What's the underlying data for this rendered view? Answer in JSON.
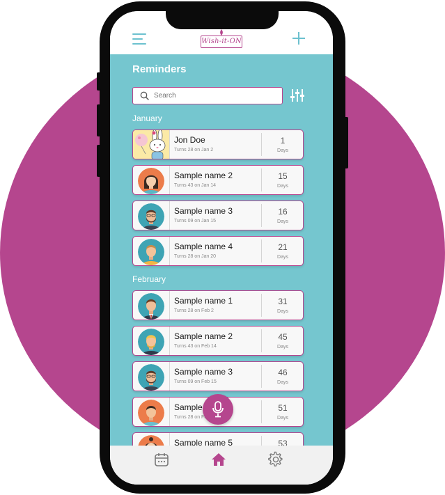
{
  "header": {
    "logo_text": "Wish-it-ON"
  },
  "screen": {
    "title": "Reminders"
  },
  "search": {
    "placeholder": "Search"
  },
  "months": [
    {
      "label": "January",
      "reminders": [
        {
          "name": "Jon Doe",
          "subtitle": "Turns 28 on Jan 2",
          "days": "1",
          "days_label": "Days",
          "avatar": "bunny-illustration"
        },
        {
          "name": "Sample name 2",
          "subtitle": "Turns 43 on Jan 14",
          "days": "15",
          "days_label": "Days",
          "avatar": "woman-avatar"
        },
        {
          "name": "Sample name 3",
          "subtitle": "Turns 09 on Jan 15",
          "days": "16",
          "days_label": "Days",
          "avatar": "bearded-man-avatar"
        },
        {
          "name": "Sample name 4",
          "subtitle": "Turns 28 on Jan 20",
          "days": "21",
          "days_label": "Days",
          "avatar": "man-avatar"
        }
      ]
    },
    {
      "label": "February",
      "reminders": [
        {
          "name": "Sample name 1",
          "subtitle": "Turns 28 on Feb 2",
          "days": "31",
          "days_label": "Days",
          "avatar": "man-in-suit-avatar"
        },
        {
          "name": "Sample name 2",
          "subtitle": "Turns 43 on Feb 14",
          "days": "45",
          "days_label": "Days",
          "avatar": "blond-man-avatar"
        },
        {
          "name": "Sample name 3",
          "subtitle": "Turns 09 on Feb 15",
          "days": "46",
          "days_label": "Days",
          "avatar": "bearded-man-avatar"
        },
        {
          "name": "Sample name 4",
          "subtitle": "Turns 28 on Feb 20",
          "days": "51",
          "days_label": "Days",
          "avatar": "man-avatar"
        },
        {
          "name": "Sample name 5",
          "subtitle": "",
          "days": "53",
          "days_label": "",
          "avatar": "woman-avatar"
        }
      ]
    }
  ],
  "icons": {
    "menu": "hamburger-menu-icon",
    "add": "plus-icon",
    "search": "search-icon",
    "filter": "filter-sliders-icon",
    "voice": "microphone-icon",
    "nav": [
      "calendar-icon",
      "home-icon",
      "settings-gear-icon"
    ]
  },
  "colors": {
    "accent": "#b5468e",
    "teal": "#75c6cf",
    "icon_teal": "#6cc1cf"
  }
}
